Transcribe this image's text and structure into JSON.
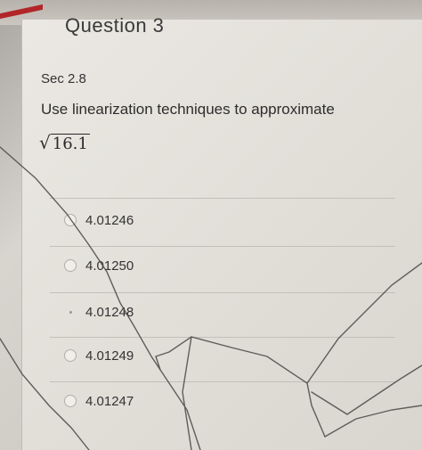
{
  "question": {
    "title": "Question 3",
    "section": "Sec 2.8",
    "prompt": "Use linearization techniques to approximate",
    "expression_radicand": "16.1"
  },
  "options": [
    {
      "label": "4.01246",
      "selected": false
    },
    {
      "label": "4.01250",
      "selected": false
    },
    {
      "label": "4.01248",
      "selected": true
    },
    {
      "label": "4.01249",
      "selected": false
    },
    {
      "label": "4.01247",
      "selected": false
    }
  ],
  "colors": {
    "accent_red": "#b2262a",
    "card_bg": "#e8e5df",
    "text": "#333333"
  }
}
